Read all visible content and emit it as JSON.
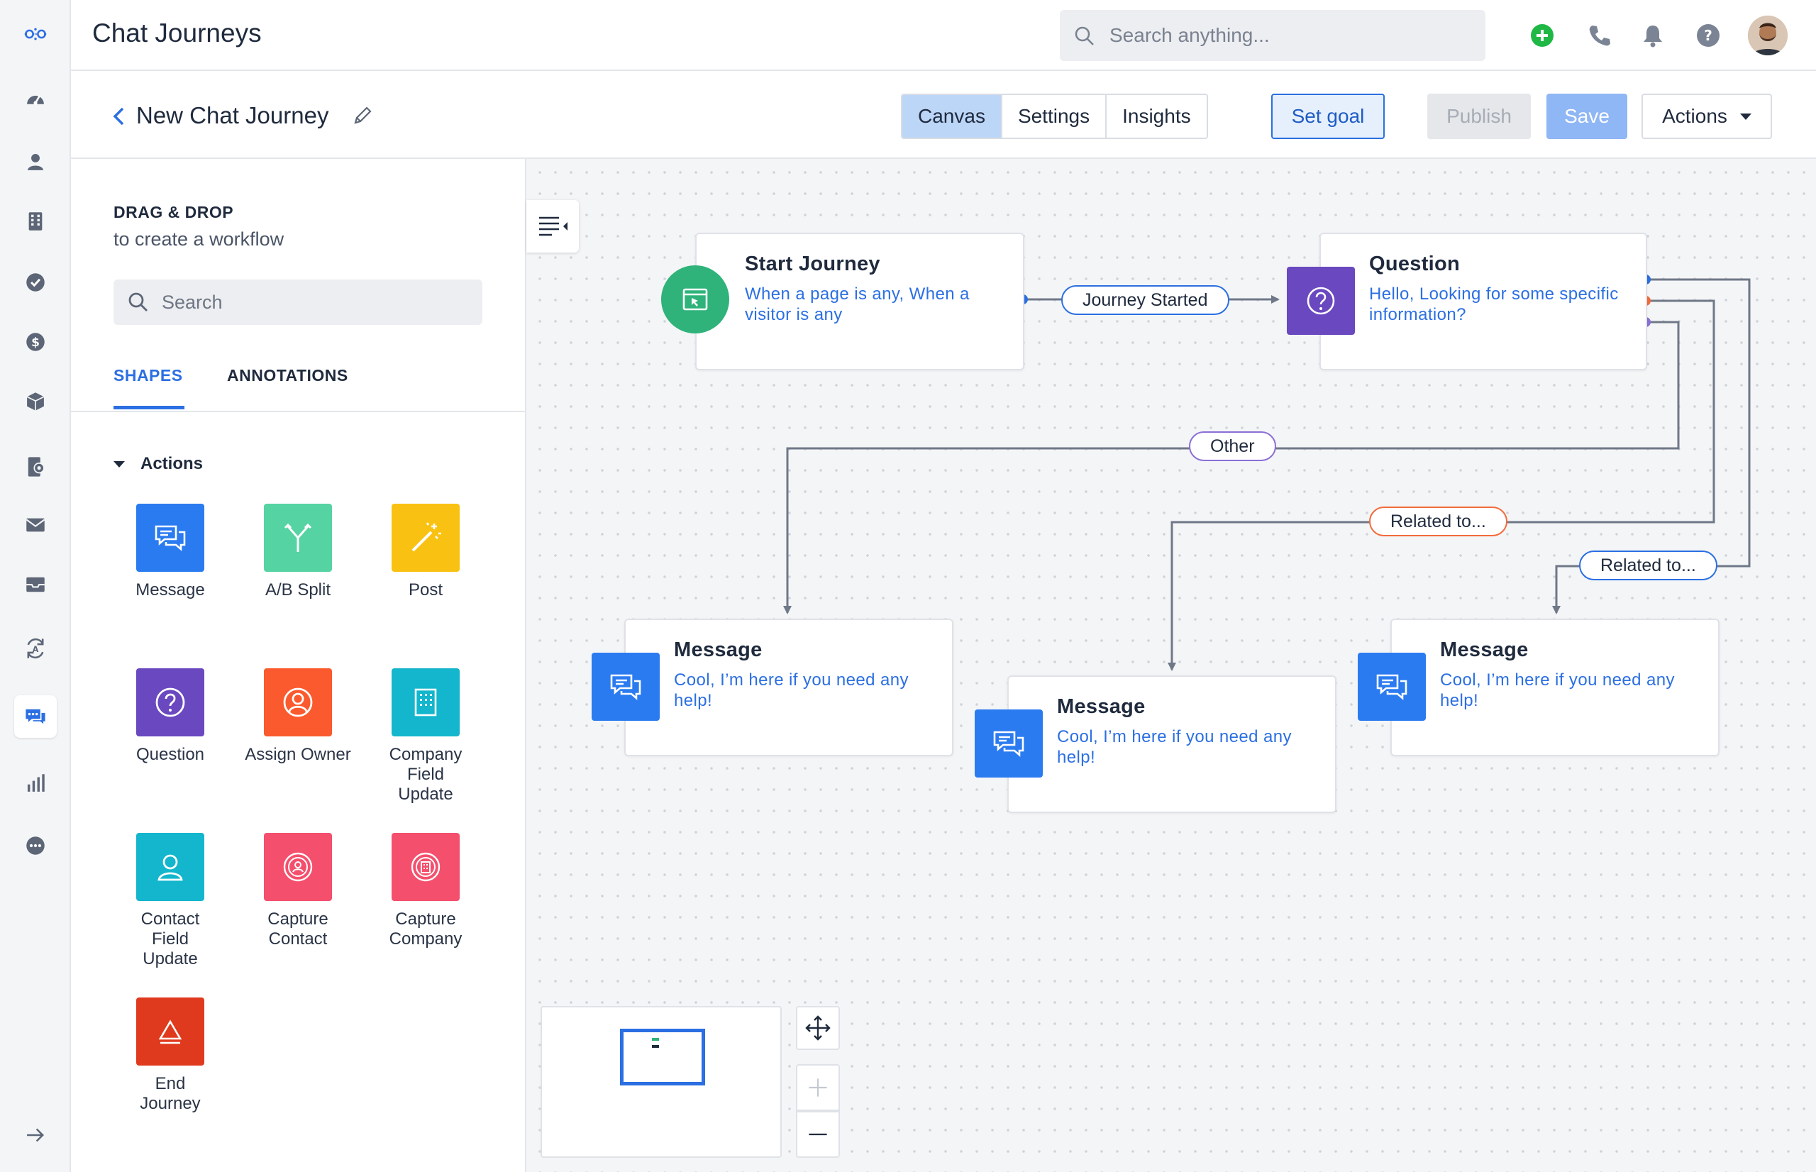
{
  "app": {
    "title": "Chat Journeys"
  },
  "search": {
    "placeholder": "Search anything..."
  },
  "rail": {
    "icons": [
      "logo-icon",
      "dashboard-icon",
      "contacts-icon",
      "accounts-icon",
      "tasks-icon",
      "deals-icon",
      "products-icon",
      "forms-icon",
      "email-icon",
      "inbox-icon",
      "automation-icon",
      "chat-journeys-icon",
      "reports-icon",
      "more-icon",
      "expand-arrow-icon"
    ]
  },
  "header_icons": [
    "add-icon",
    "phone-icon",
    "bell-icon",
    "help-icon"
  ],
  "journey": {
    "title": "New Chat Journey"
  },
  "view_tabs": [
    {
      "label": "Canvas",
      "active": true
    },
    {
      "label": "Settings",
      "active": false
    },
    {
      "label": "Insights",
      "active": false
    }
  ],
  "toolbar": {
    "set_goal": "Set goal",
    "publish": "Publish",
    "save": "Save",
    "actions": "Actions"
  },
  "panel": {
    "title": "DRAG & DROP",
    "subtitle": "to create a workflow",
    "search_placeholder": "Search",
    "tabs": {
      "shapes": "SHAPES",
      "annotations": "ANNOTATIONS"
    },
    "group": "Actions",
    "shapes": [
      {
        "label": "Message",
        "color": "#2b7bf0",
        "icon": "chat-bubbles-icon"
      },
      {
        "label": "A/B Split",
        "color": "#56d3a2",
        "icon": "split-icon"
      },
      {
        "label": "Post",
        "color": "#f9c212",
        "icon": "magic-wand-icon"
      },
      {
        "label": "Question",
        "color": "#6a48bf",
        "icon": "question-icon"
      },
      {
        "label": "Assign Owner",
        "color": "#fa5a2d",
        "icon": "owner-icon"
      },
      {
        "label": "Company Field Update",
        "color": "#13b6cc",
        "icon": "building-icon"
      },
      {
        "label": "Contact Field Update",
        "color": "#13b6cc",
        "icon": "contact-icon"
      },
      {
        "label": "Capture Contact",
        "color": "#f44f6c",
        "icon": "capture-contact-icon"
      },
      {
        "label": "Capture Company",
        "color": "#f44f6c",
        "icon": "capture-company-icon"
      },
      {
        "label": "End Journey",
        "color": "#e03a1e",
        "icon": "end-icon"
      }
    ]
  },
  "canvas": {
    "nodes": {
      "start": {
        "title": "Start Journey",
        "desc": "When a page is any, When a visitor is any",
        "color": "#2fb37a",
        "icon": "browser-cursor-icon"
      },
      "question": {
        "title": "Question",
        "desc": "Hello, Looking for some specific information?",
        "color": "#6a48bf",
        "icon": "question-icon"
      },
      "message1": {
        "title": "Message",
        "desc": "Cool, I’m here if you need any help!",
        "color": "#2b7bf0",
        "icon": "chat-bubbles-icon"
      },
      "message2": {
        "title": "Message",
        "desc": "Cool, I’m here if you need any help!",
        "color": "#2b7bf0",
        "icon": "chat-bubbles-icon"
      },
      "message3": {
        "title": "Message",
        "desc": "Cool, I’m here if you need any help!",
        "color": "#2b7bf0",
        "icon": "chat-bubbles-icon"
      }
    },
    "edges": {
      "started": "Journey Started",
      "other": "Other",
      "related1": "Related to...",
      "related2": "Related to..."
    },
    "port_colors": {
      "blue": "#2b6fe2",
      "orange": "#f26b3a",
      "purple": "#8b6fd6"
    }
  }
}
